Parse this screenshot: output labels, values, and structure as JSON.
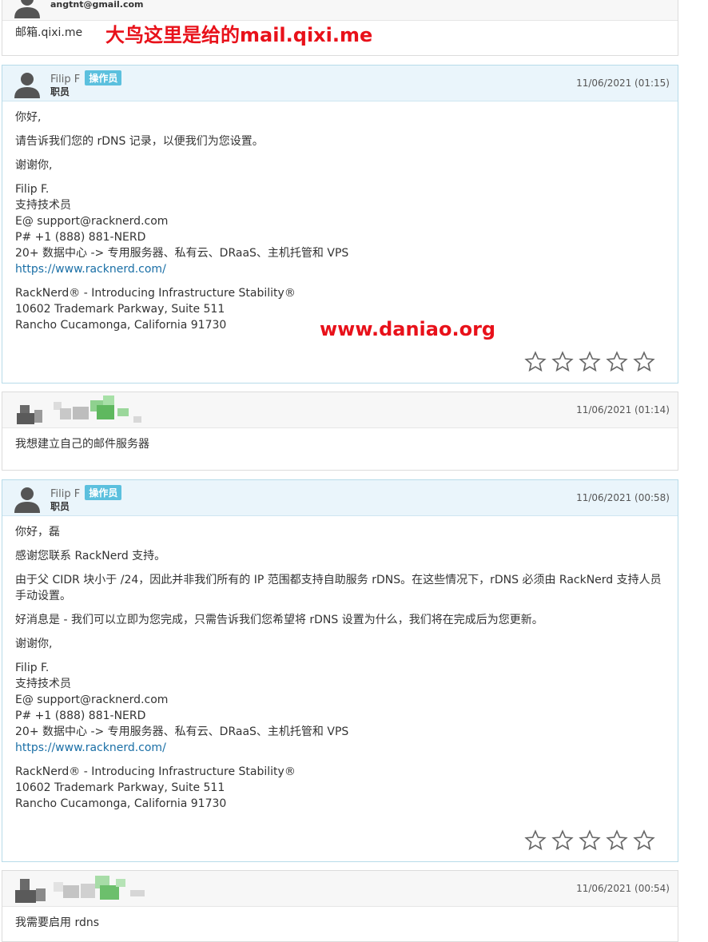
{
  "top_partial": {
    "email": "angtnt@gmail.com",
    "message": "邮箱.qixi.me"
  },
  "watermarks": {
    "top": "大鸟这里是给的mail.qixi.me",
    "mid": "www.daniao.org"
  },
  "messages": [
    {
      "author": "Filip F",
      "badge": "操作员",
      "role": "职员",
      "date": "11/06/2021 (01:15)",
      "greeting": "你好,",
      "paragraphs": [
        "请告诉我们您的 rDNS 记录，以便我们为您设置。",
        "谢谢你,"
      ],
      "signature": [
        "Filip F.",
        "支持技术员",
        "E@ support@racknerd.com",
        "P# +1 (888) 881-NERD",
        "20+ 数据中心 -> 专用服务器、私有云、DRaaS、主机托管和 VPS"
      ],
      "link": "https://www.racknerd.com/",
      "address": [
        "RackNerd® - Introducing Infrastructure Stability®",
        "10602 Trademark Parkway, Suite 511",
        "Rancho Cucamonga, California 91730"
      ]
    },
    {
      "date": "11/06/2021 (01:14)",
      "text": "我想建立自己的邮件服务器"
    },
    {
      "author": "Filip F",
      "badge": "操作员",
      "role": "职员",
      "date": "11/06/2021 (00:58)",
      "greeting": "你好，磊",
      "paragraphs": [
        "感谢您联系 RackNerd 支持。",
        "由于父 CIDR 块小于 /24，因此并非我们所有的 IP 范围都支持自助服务 rDNS。在这些情况下，rDNS 必须由 RackNerd 支持人员手动设置。",
        "好消息是 - 我们可以立即为您完成，只需告诉我们您希望将 rDNS 设置为什么，我们将在完成后为您更新。",
        "谢谢你,"
      ],
      "signature": [
        "Filip F.",
        "支持技术员",
        "E@ support@racknerd.com",
        "P# +1 (888) 881-NERD",
        "20+ 数据中心 -> 专用服务器、私有云、DRaaS、主机托管和 VPS"
      ],
      "link": "https://www.racknerd.com/",
      "address": [
        "RackNerd® - Introducing Infrastructure Stability®",
        "10602 Trademark Parkway, Suite 511",
        "Rancho Cucamonga, California 91730"
      ]
    },
    {
      "date": "11/06/2021 (00:54)",
      "text": "我需要启用 rdns"
    }
  ],
  "icons": {
    "avatar": "user-silhouette-icon",
    "rating": "star-outline-icon"
  },
  "colors": {
    "staff_badge": "#5bc0de",
    "watermark": "#e8111a",
    "link": "#1a6fa6"
  }
}
